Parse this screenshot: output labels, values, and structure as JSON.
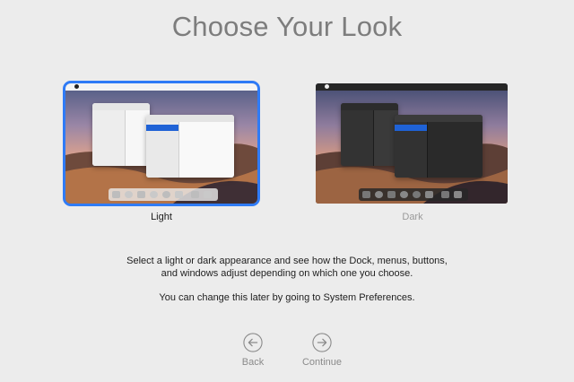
{
  "header": {
    "title": "Choose Your Look"
  },
  "options": {
    "light": {
      "label": "Light",
      "selected": true,
      "accent": "#2f7bf6"
    },
    "dark": {
      "label": "Dark",
      "selected": false
    }
  },
  "description": {
    "line1": "Select a light or dark appearance and see how the Dock, menus, buttons,",
    "line2": "and windows adjust depending on which one you choose.",
    "line3": "You can change this later by going to System Preferences."
  },
  "navigation": {
    "back": {
      "label": "Back",
      "icon": "arrow-left-circle-icon"
    },
    "continue": {
      "label": "Continue",
      "icon": "arrow-right-circle-icon"
    }
  }
}
